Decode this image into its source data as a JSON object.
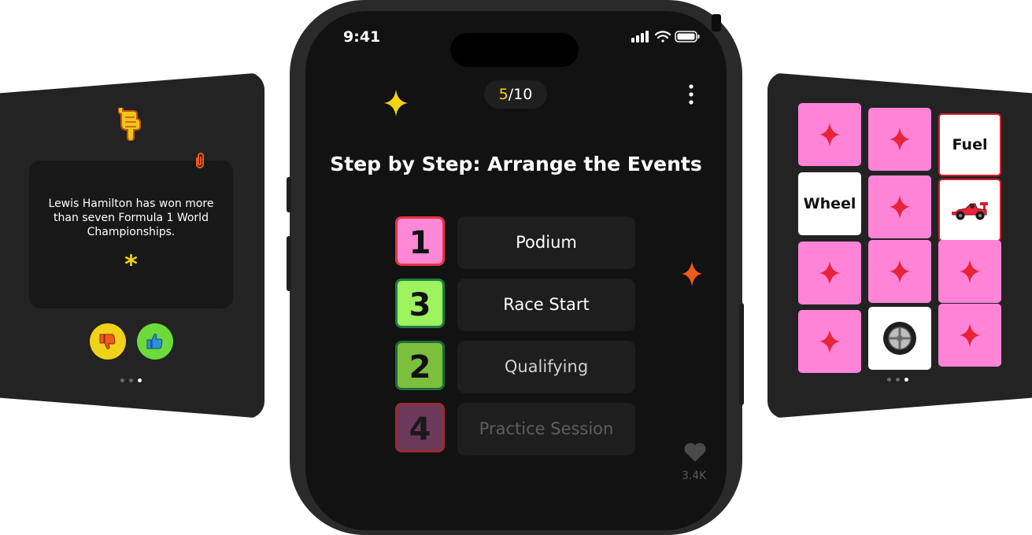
{
  "left_card": {
    "fact_text": "Lewis Hamilton has won more than seven Formula 1 World Championships.",
    "asterisk": "*",
    "icons": [
      "pointing-hand-icon",
      "paperclip-icon",
      "thumbs-down-icon",
      "thumbs-up-icon"
    ],
    "page_dots": 3,
    "active_dot": 2
  },
  "phone": {
    "status_time": "9:41",
    "progress_current": "5",
    "progress_total": "/10",
    "title": "Step by Step: Arrange the Events",
    "answers": [
      {
        "number": "1",
        "label": "Podium",
        "tile_color": "#ff88d6",
        "border_color": "#e8333f"
      },
      {
        "number": "3",
        "label": "Race Start",
        "tile_color": "#9ef25e",
        "border_color": "#1f7d44"
      },
      {
        "number": "2",
        "label": "Qualifying",
        "tile_color": "#7bbf3d",
        "border_color": "#1f6a3a"
      },
      {
        "number": "4",
        "label": "Practice Session",
        "tile_color": "#6b3a5a",
        "border_color": "#9b2a35"
      }
    ],
    "likes": "3.4K"
  },
  "right_card": {
    "grid": [
      {
        "type": "pink"
      },
      {
        "type": "pink"
      },
      {
        "type": "text",
        "label": "Fuel"
      },
      {
        "type": "text",
        "label": "Wheel"
      },
      {
        "type": "pink"
      },
      {
        "type": "car-icon"
      },
      {
        "type": "pink"
      },
      {
        "type": "pink"
      },
      {
        "type": "pink"
      },
      {
        "type": "pink"
      },
      {
        "type": "tire-icon"
      },
      {
        "type": "pink"
      }
    ],
    "page_dots": 3,
    "active_dot": 2
  },
  "colors": {
    "accent_yellow": "#f4d312",
    "sparkle_red": "#e8233a",
    "sparkle_orange": "#f05a1a",
    "tile_pink": "#ff84d8"
  }
}
